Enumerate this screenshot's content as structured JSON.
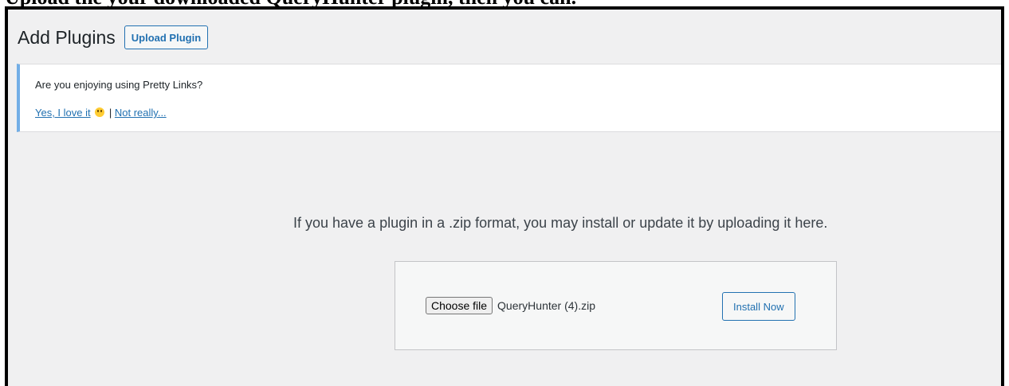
{
  "caption": "Upload the your downloaded QueryHunter plugin, then you can.",
  "header": {
    "title": "Add Plugins",
    "upload_label": "Upload Plugin"
  },
  "notice": {
    "question": "Are you enjoying using Pretty Links?",
    "yes_label": "Yes, I love it",
    "separator": "|",
    "no_label": "Not really..."
  },
  "upload": {
    "help_text": "If you have a plugin in a .zip format, you may install or update it by uploading it here.",
    "choose_label": "Choose file",
    "file_name": "QueryHunter (4).zip",
    "install_label": "Install Now"
  },
  "colors": {
    "accent": "#2271b1",
    "notice_border": "#72aee6",
    "background": "#f0f0f1"
  }
}
